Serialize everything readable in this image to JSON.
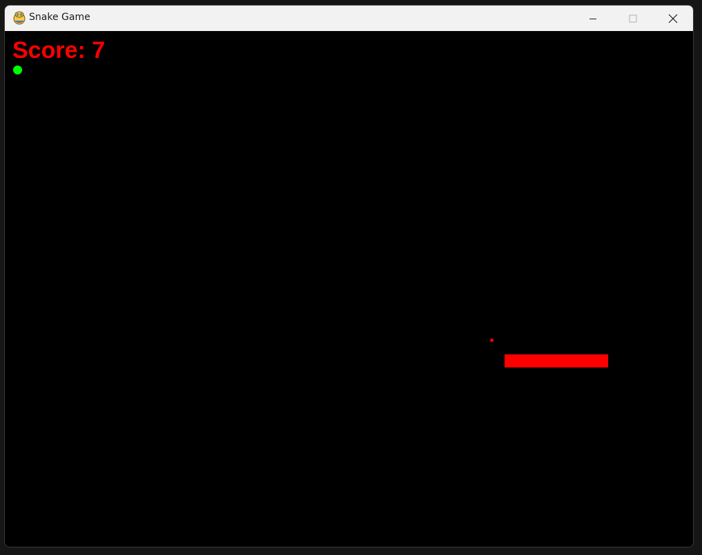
{
  "window": {
    "title": "Snake Game",
    "app_icon": "pygame-snake-icon",
    "controls": [
      "minimize-icon",
      "maximize-icon",
      "close-icon"
    ]
  },
  "game": {
    "score_label": "Score: 7",
    "score": 7,
    "colors": {
      "background": "#000000",
      "score_text": "#ff0000",
      "snake": "#ff0000",
      "food": "#ff0000",
      "indicator": "#00ff00",
      "titlebar": "#f2f2f2"
    },
    "snake_length": 5
  }
}
